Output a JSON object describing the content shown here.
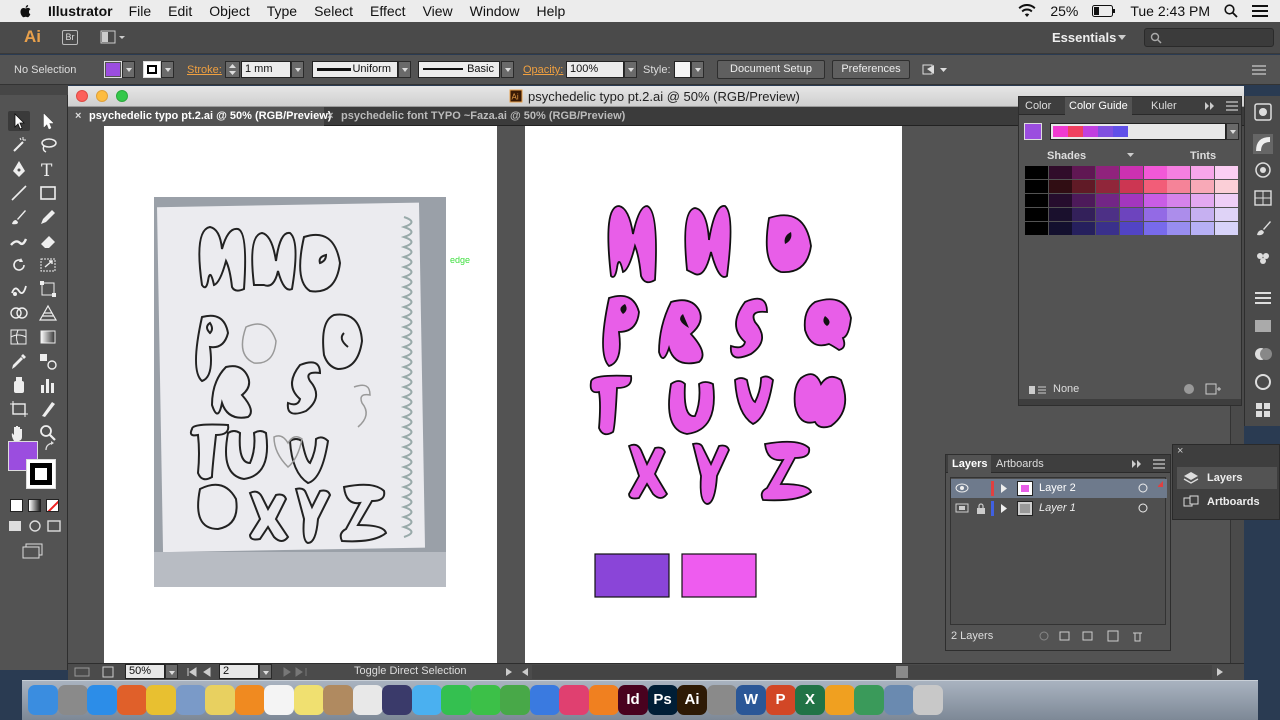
{
  "menubar": {
    "app_name": "Illustrator",
    "items": [
      "File",
      "Edit",
      "Object",
      "Type",
      "Select",
      "Effect",
      "View",
      "Window",
      "Help"
    ],
    "battery": "25%",
    "clock": "Tue 2:43 PM"
  },
  "appbar": {
    "logo": "Ai",
    "bridge": "Br",
    "workspace": "Essentials"
  },
  "controlbar": {
    "selection": "No Selection",
    "fill_color": "#9b4ddf",
    "stroke_label": "Stroke:",
    "stroke_weight": "1 mm",
    "profile": "Uniform",
    "brush": "Basic",
    "opacity_label": "Opacity:",
    "opacity": "100%",
    "style_label": "Style:",
    "document_setup": "Document Setup",
    "preferences": "Preferences"
  },
  "tools": {
    "fill_color": "#9b4ddf",
    "stroke_color": "#000000"
  },
  "document": {
    "title": "psychedelic typo pt.2.ai @ 50% (RGB/Preview)",
    "tabs": [
      {
        "label": "psychedelic typo pt.2.ai @ 50% (RGB/Preview)",
        "active": true
      },
      {
        "label": "psychedelic font TYPO ~Faza.ai @ 50% (RGB/Preview)",
        "active": false
      }
    ],
    "photo_label": "edge",
    "letters": {
      "row1": [
        "M",
        "N",
        "O"
      ],
      "row2": [
        "P",
        "R",
        "S",
        "Q"
      ],
      "row3": [
        "T",
        "U",
        "V",
        "W"
      ],
      "row4": [
        "X",
        "Y",
        "Z"
      ]
    },
    "letter_color": "#e85ee8",
    "swatches": [
      "#8a45d8",
      "#ee5cef"
    ]
  },
  "statusbar": {
    "zoom": "50%",
    "artboard": "2",
    "status_text": "Toggle Direct Selection"
  },
  "color_panel": {
    "tabs": [
      "Color",
      "Color Guide",
      "Kuler"
    ],
    "active_tab": "Color Guide",
    "shades_label": "Shades",
    "tints_label": "Tints",
    "none_label": "None",
    "harmony": [
      "#f03ad0",
      "#f04060",
      "#c040e0",
      "#8050e0",
      "#6050e8"
    ]
  },
  "layers_panel": {
    "tabs": [
      "Layers",
      "Artboards"
    ],
    "layers": [
      {
        "name": "Layer 2",
        "color": "#e04040"
      },
      {
        "name": "Layer 1",
        "color": "#4060e0"
      }
    ],
    "count": "2 Layers"
  },
  "flyout": {
    "items": [
      "Layers",
      "Artboards"
    ]
  },
  "dock_apps": [
    "Finder",
    "Launchpad",
    "Safari",
    "Firefox",
    "Chrome",
    "Preview",
    "Notes",
    "VLC",
    "Calendar",
    "Stickies",
    "Contacts",
    "Photos",
    "iMovie",
    "Messages",
    "LINE",
    "FaceTime",
    "Numbers",
    "Keynote",
    "iTunes",
    "iBooks",
    "InDesign",
    "Photoshop",
    "Illustrator",
    "System Preferences",
    "Word",
    "PowerPoint",
    "Excel",
    "Office",
    "Maps",
    "Preview2",
    "Trash"
  ]
}
